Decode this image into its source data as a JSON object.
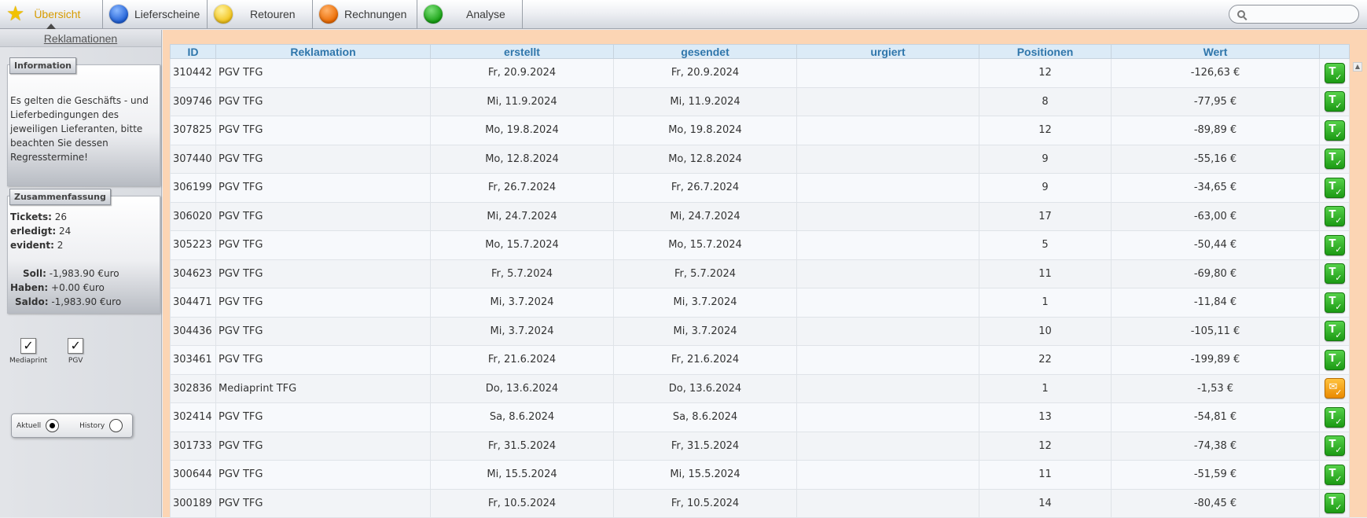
{
  "nav": {
    "tabs": [
      {
        "label": "Übersicht",
        "icon": "star-icon",
        "active": true
      },
      {
        "label": "Lieferscheine",
        "icon": "blue-dot-icon"
      },
      {
        "label": "Retouren",
        "icon": "yellow-dot-icon"
      },
      {
        "label": "Rechnungen",
        "icon": "orange-dot-icon"
      },
      {
        "label": "Analyse",
        "icon": "green-dot-icon"
      }
    ],
    "search_placeholder": ""
  },
  "sidebar": {
    "title": "Reklamationen",
    "information": {
      "tab": "Information",
      "text": "Es gelten die Geschäfts - und Lieferbedingungen des jeweiligen Lieferanten, bitte beachten Sie dessen Regresstermine!"
    },
    "summary": {
      "tab": "Zusammenfassung",
      "tickets_label": "Tickets:",
      "tickets_value": "26",
      "done_label": "erledigt:",
      "done_value": "24",
      "evident_label": "evident:",
      "evident_value": "2",
      "soll_label": "Soll:",
      "soll_value": "-1,983.90 €uro",
      "haben_label": "Haben:",
      "haben_value": "+0.00 €uro",
      "saldo_label": "Saldo:",
      "saldo_value": "-1,983.90 €uro"
    },
    "filters": [
      {
        "label": "Mediaprint",
        "checked": true,
        "mark": "✓"
      },
      {
        "label": "PGV",
        "checked": true,
        "mark": "✓"
      }
    ],
    "mode": {
      "aktuell": "Aktuell",
      "history": "History",
      "selected": "Aktuell"
    }
  },
  "table": {
    "columns": [
      "ID",
      "Reklamation",
      "erstellt",
      "gesendet",
      "urgiert",
      "Positionen",
      "Wert",
      ""
    ],
    "rows": [
      {
        "id": "310442",
        "name": "PGV TFG",
        "created": "Fr, 20.9.2024",
        "sent": "Fr, 20.9.2024",
        "urged": "",
        "positions": "12",
        "value": "-126,63 €",
        "status": "green"
      },
      {
        "id": "309746",
        "name": "PGV TFG",
        "created": "Mi, 11.9.2024",
        "sent": "Mi, 11.9.2024",
        "urged": "",
        "positions": "8",
        "value": "-77,95 €",
        "status": "green"
      },
      {
        "id": "307825",
        "name": "PGV TFG",
        "created": "Mo, 19.8.2024",
        "sent": "Mo, 19.8.2024",
        "urged": "",
        "positions": "12",
        "value": "-89,89 €",
        "status": "green"
      },
      {
        "id": "307440",
        "name": "PGV TFG",
        "created": "Mo, 12.8.2024",
        "sent": "Mo, 12.8.2024",
        "urged": "",
        "positions": "9",
        "value": "-55,16 €",
        "status": "green"
      },
      {
        "id": "306199",
        "name": "PGV TFG",
        "created": "Fr, 26.7.2024",
        "sent": "Fr, 26.7.2024",
        "urged": "",
        "positions": "9",
        "value": "-34,65 €",
        "status": "green"
      },
      {
        "id": "306020",
        "name": "PGV TFG",
        "created": "Mi, 24.7.2024",
        "sent": "Mi, 24.7.2024",
        "urged": "",
        "positions": "17",
        "value": "-63,00 €",
        "status": "green"
      },
      {
        "id": "305223",
        "name": "PGV TFG",
        "created": "Mo, 15.7.2024",
        "sent": "Mo, 15.7.2024",
        "urged": "",
        "positions": "5",
        "value": "-50,44 €",
        "status": "green"
      },
      {
        "id": "304623",
        "name": "PGV TFG",
        "created": "Fr, 5.7.2024",
        "sent": "Fr, 5.7.2024",
        "urged": "",
        "positions": "11",
        "value": "-69,80 €",
        "status": "green"
      },
      {
        "id": "304471",
        "name": "PGV TFG",
        "created": "Mi, 3.7.2024",
        "sent": "Mi, 3.7.2024",
        "urged": "",
        "positions": "1",
        "value": "-11,84 €",
        "status": "green"
      },
      {
        "id": "304436",
        "name": "PGV TFG",
        "created": "Mi, 3.7.2024",
        "sent": "Mi, 3.7.2024",
        "urged": "",
        "positions": "10",
        "value": "-105,11 €",
        "status": "green"
      },
      {
        "id": "303461",
        "name": "PGV TFG",
        "created": "Fr, 21.6.2024",
        "sent": "Fr, 21.6.2024",
        "urged": "",
        "positions": "22",
        "value": "-199,89 €",
        "status": "green"
      },
      {
        "id": "302836",
        "name": "Mediaprint TFG",
        "created": "Do, 13.6.2024",
        "sent": "Do, 13.6.2024",
        "urged": "",
        "positions": "1",
        "value": "-1,53 €",
        "status": "orange"
      },
      {
        "id": "302414",
        "name": "PGV TFG",
        "created": "Sa, 8.6.2024",
        "sent": "Sa, 8.6.2024",
        "urged": "",
        "positions": "13",
        "value": "-54,81 €",
        "status": "green"
      },
      {
        "id": "301733",
        "name": "PGV TFG",
        "created": "Fr, 31.5.2024",
        "sent": "Fr, 31.5.2024",
        "urged": "",
        "positions": "12",
        "value": "-74,38 €",
        "status": "green"
      },
      {
        "id": "300644",
        "name": "PGV TFG",
        "created": "Mi, 15.5.2024",
        "sent": "Mi, 15.5.2024",
        "urged": "",
        "positions": "11",
        "value": "-51,59 €",
        "status": "green"
      },
      {
        "id": "300189",
        "name": "PGV TFG",
        "created": "Fr, 10.5.2024",
        "sent": "Fr, 10.5.2024",
        "urged": "",
        "positions": "14",
        "value": "-80,45 €",
        "status": "green"
      }
    ]
  },
  "colors": {
    "accent": "#d79b00",
    "header_text": "#2f76ab",
    "main_bg": "#fcd5b4",
    "ok": "#1c9a14",
    "pending": "#ea8a00"
  }
}
